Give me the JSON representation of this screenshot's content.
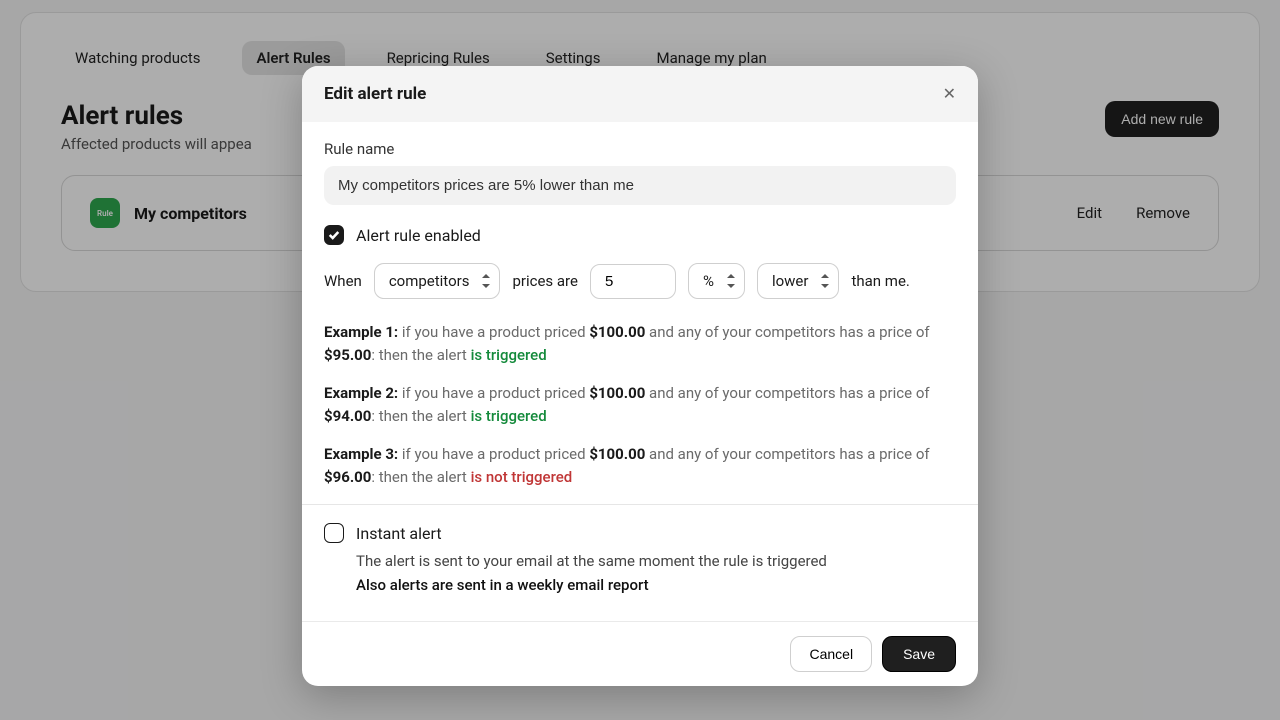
{
  "tabs": [
    "Watching products",
    "Alert Rules",
    "Repricing Rules",
    "Settings",
    "Manage my plan"
  ],
  "active_tab_index": 1,
  "page": {
    "title": "Alert rules",
    "subtitle_visible": "Affected products will appea",
    "add_button": "Add new rule"
  },
  "rule_row": {
    "badge_text": "Rule",
    "name_visible": "My competitors",
    "edit_label": "Edit",
    "remove_label": "Remove"
  },
  "modal": {
    "title": "Edit alert rule",
    "rule_name_label": "Rule name",
    "rule_name_value": "My competitors prices are 5% lower than me",
    "enabled_label": "Alert rule enabled",
    "enabled_checked": true,
    "sentence": {
      "when": "When",
      "who": "competitors",
      "prices_are": "prices are",
      "amount": "5",
      "unit": "%",
      "direction": "lower",
      "than_me": "than me."
    },
    "examples": [
      {
        "lead": "Example 1:",
        "pre": " if you have a product priced ",
        "p1": "$100.00",
        "mid": " and any of your competitors has a price of ",
        "p2": "$95.00",
        "post": ": then the alert ",
        "outcome": "is triggered",
        "outcome_class": "trig-green"
      },
      {
        "lead": "Example 2:",
        "pre": " if you have a product priced ",
        "p1": "$100.00",
        "mid": " and any of your competitors has a price of ",
        "p2": "$94.00",
        "post": ": then the alert ",
        "outcome": "is triggered",
        "outcome_class": "trig-green"
      },
      {
        "lead": "Example 3:",
        "pre": " if you have a product priced ",
        "p1": "$100.00",
        "mid": " and any of your competitors has a price of ",
        "p2": "$96.00",
        "post": ": then the alert ",
        "outcome": "is not triggered",
        "outcome_class": "trig-red"
      }
    ],
    "instant": {
      "label": "Instant alert",
      "checked": false,
      "desc1": "The alert is sent to your email at the same moment the rule is triggered",
      "desc2": "Also alerts are sent in a weekly email report"
    },
    "footer": {
      "cancel": "Cancel",
      "save": "Save"
    }
  }
}
